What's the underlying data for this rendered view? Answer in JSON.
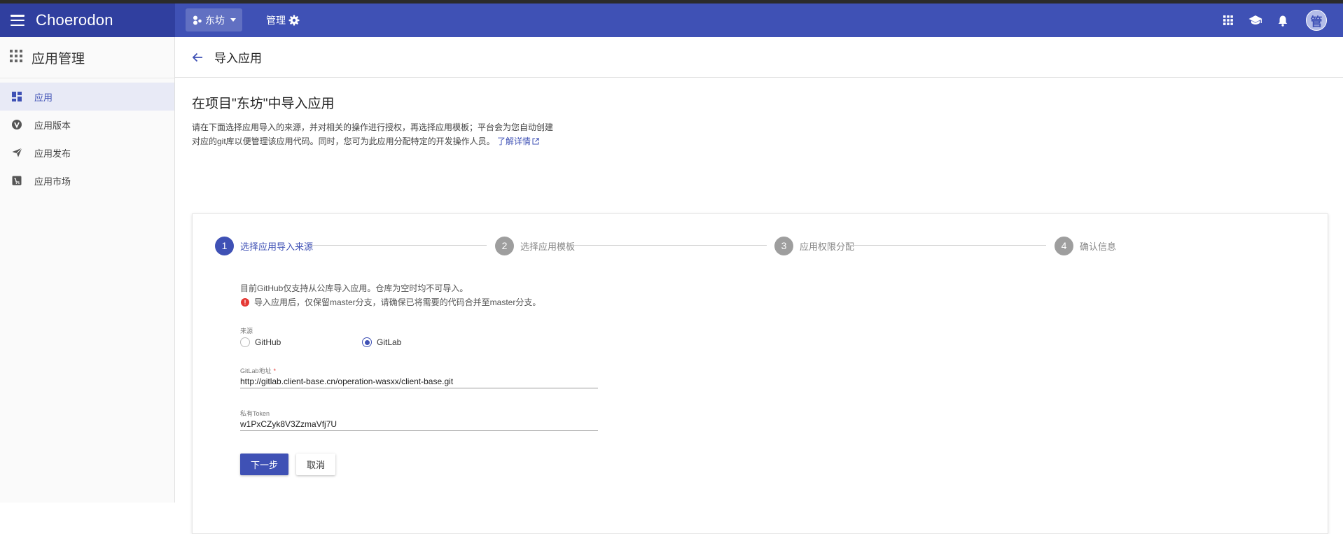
{
  "header": {
    "brand": "Choerodon",
    "project": "东坊",
    "manage": "管理",
    "avatar": "管",
    "icons": [
      "apps-grid-icon",
      "graduation-cap-icon",
      "notification-bell-icon"
    ]
  },
  "sidebar": {
    "title": "应用管理",
    "items": [
      {
        "label": "应用",
        "icon": "dashboard-icon",
        "active": true
      },
      {
        "label": "应用版本",
        "icon": "version-icon",
        "active": false
      },
      {
        "label": "应用发布",
        "icon": "send-icon",
        "active": false
      },
      {
        "label": "应用市场",
        "icon": "store-icon",
        "active": false
      }
    ]
  },
  "page": {
    "title": "导入应用",
    "heading": "在项目\"东坊\"中导入应用",
    "description": "请在下面选择应用导入的来源，并对相关的操作进行授权，再选择应用模板；平台会为您自动创建对应的git库以便管理该应用代码。同时，您可为此应用分配特定的开发操作人员。",
    "learn_more": "了解详情"
  },
  "steps": [
    {
      "num": "1",
      "label": "选择应用导入来源",
      "active": true
    },
    {
      "num": "2",
      "label": "选择应用模板",
      "active": false
    },
    {
      "num": "3",
      "label": "应用权限分配",
      "active": false
    },
    {
      "num": "4",
      "label": "确认信息",
      "active": false
    }
  ],
  "form": {
    "notice": "目前GitHub仅支持从公库导入应用。仓库为空时均不可导入。",
    "warning": "导入应用后，仅保留master分支，请确保已将需要的代码合并至master分支。",
    "source_label": "来源",
    "source_options": [
      "GitHub",
      "GitLab"
    ],
    "source_selected": "GitLab",
    "gitlab_label": "GitLab地址",
    "gitlab_required": "*",
    "gitlab_value": "http://gitlab.client-base.cn/operation-wasxx/client-base.git",
    "token_label": "私有Token",
    "token_value": "w1PxCZyk8V3ZzmaVfj7U",
    "next_button": "下一步",
    "cancel_button": "取消"
  },
  "colors": {
    "primary": "#3f51b5",
    "header_dark": "#303f9f",
    "error": "#e53935"
  }
}
